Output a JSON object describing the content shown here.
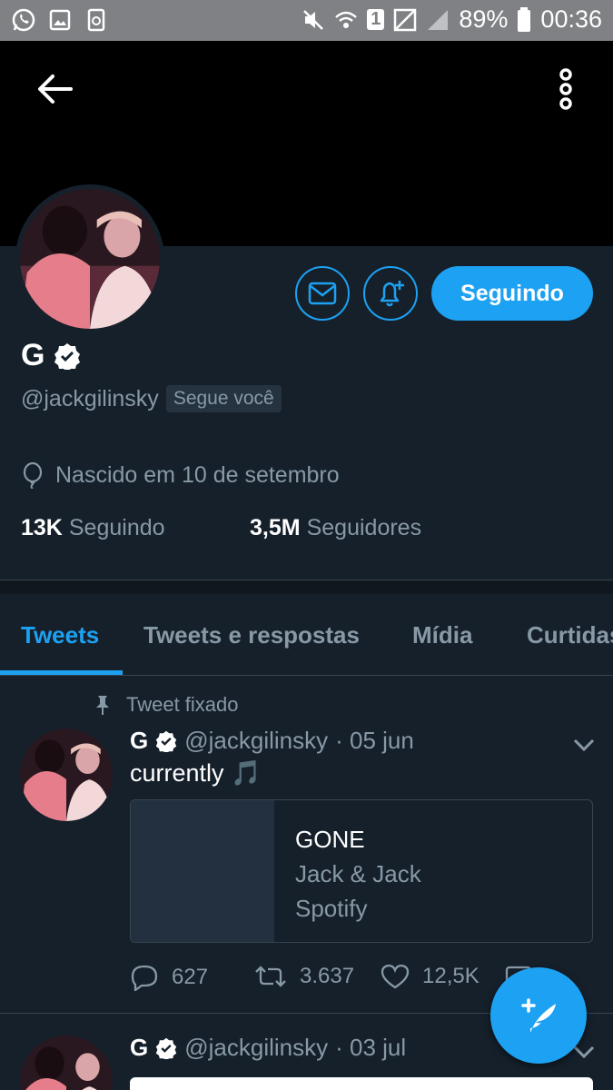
{
  "status_bar": {
    "icons_left": [
      "whatsapp-icon",
      "gallery-icon",
      "recycle-icon"
    ],
    "battery": "89%",
    "time": "00:36",
    "sim": "1"
  },
  "colors": {
    "accent": "#1da1f2",
    "background": "#15202b",
    "muted": "#8899a6"
  },
  "profile": {
    "name": "G",
    "handle": "@jackgilinsky",
    "follows_you": "Segue você",
    "birth": "Nascido em 10 de setembro",
    "following_count": "13K",
    "following_label": "Seguindo",
    "followers_count": "3,5M",
    "followers_label": "Seguidores",
    "follow_button": "Seguindo"
  },
  "tabs": [
    {
      "label": "Tweets",
      "active": true
    },
    {
      "label": "Tweets e respostas",
      "active": false
    },
    {
      "label": "Mídia",
      "active": false
    },
    {
      "label": "Curtidas",
      "active": false
    }
  ],
  "tweets": [
    {
      "pinned_label": "Tweet fixado",
      "name": "G",
      "handle": "@jackgilinsky",
      "date": "· 05 jun",
      "text": "currently 🎵",
      "card": {
        "title": "GONE",
        "subtitle": "Jack & Jack",
        "source": "Spotify"
      },
      "replies": "627",
      "retweets": "3.637",
      "likes": "12,5K"
    },
    {
      "name": "G",
      "handle": "@jackgilinsky",
      "date": "· 03 jul"
    }
  ]
}
